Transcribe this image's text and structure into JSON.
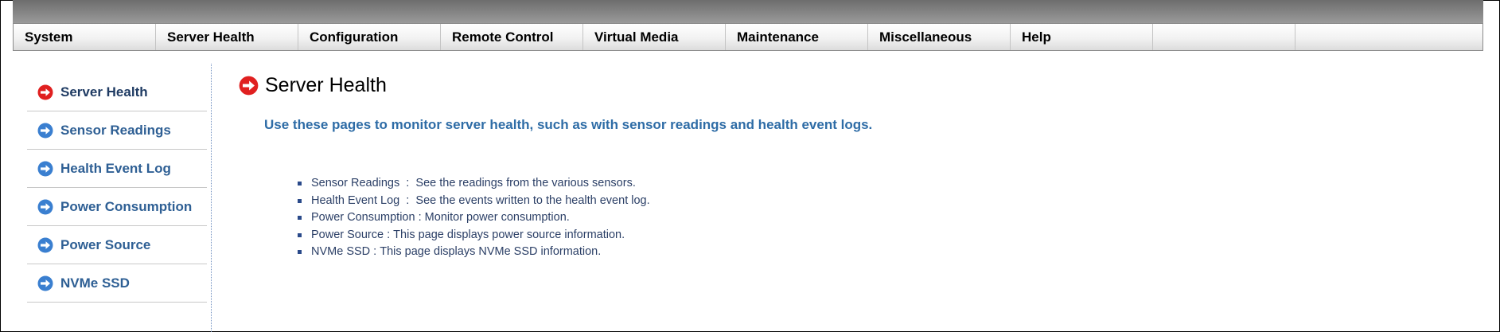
{
  "menu": [
    {
      "label": "System"
    },
    {
      "label": "Server Health"
    },
    {
      "label": "Configuration"
    },
    {
      "label": "Remote Control"
    },
    {
      "label": "Virtual Media"
    },
    {
      "label": "Maintenance"
    },
    {
      "label": "Miscellaneous"
    },
    {
      "label": "Help"
    }
  ],
  "sidebar": {
    "items": [
      {
        "label": "Server Health",
        "icon": "arrow-circle-red-icon",
        "active": true
      },
      {
        "label": "Sensor Readings",
        "icon": "arrow-circle-blue-icon"
      },
      {
        "label": "Health Event Log",
        "icon": "arrow-circle-blue-icon"
      },
      {
        "label": "Power Consumption",
        "icon": "arrow-circle-blue-icon"
      },
      {
        "label": "Power Source",
        "icon": "arrow-circle-blue-icon"
      },
      {
        "label": "NVMe SSD",
        "icon": "arrow-circle-blue-icon"
      }
    ]
  },
  "main": {
    "title": "Server Health",
    "intro": "Use these pages to monitor server health, such as with sensor readings and health event logs.",
    "links": [
      {
        "name": "Sensor Readings",
        "sep": "  :  ",
        "desc": "See the readings from the various sensors."
      },
      {
        "name": "Health Event Log",
        "sep": "  :  ",
        "desc": "See the events written to the health event log."
      },
      {
        "name": "Power Consumption",
        "sep": " : ",
        "desc": "Monitor power consumption."
      },
      {
        "name": "Power Source",
        "sep": " : ",
        "desc": "This page displays power source information."
      },
      {
        "name": "NVMe SSD",
        "sep": " : ",
        "desc": "This page displays NVMe SSD information."
      }
    ]
  },
  "colors": {
    "active_icon": "#e02020",
    "icon": "#3a7fd0",
    "link": "#2e5f94",
    "intro": "#2e6ca6"
  }
}
